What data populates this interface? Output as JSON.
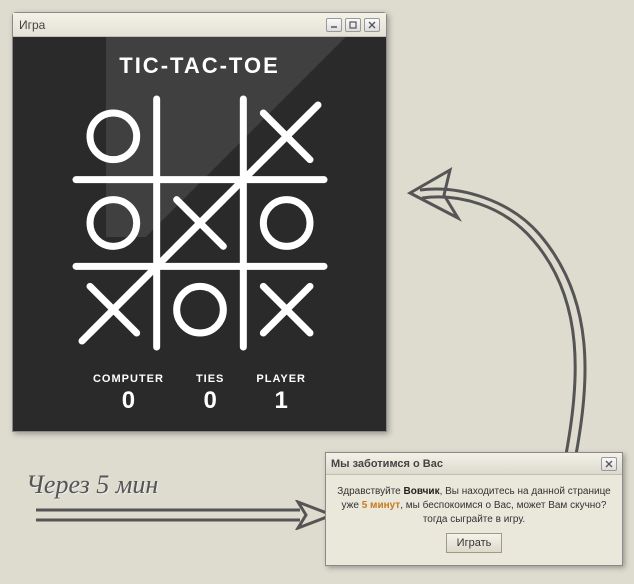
{
  "game": {
    "window_title": "Игра",
    "title": "TIC-TAC-TOE",
    "board": [
      [
        "O",
        "",
        "X"
      ],
      [
        "O",
        "X",
        "O"
      ],
      [
        "X",
        "O",
        "X"
      ]
    ],
    "win_line": [
      0,
      2,
      2,
      0
    ],
    "scores": {
      "computer": {
        "label": "COMPUTER",
        "value": "0"
      },
      "ties": {
        "label": "TIES",
        "value": "0"
      },
      "player": {
        "label": "PLAYER",
        "value": "1"
      }
    }
  },
  "caption": "Через 5 мин",
  "dialog": {
    "title": "Мы заботимся о Вас",
    "greet_prefix": "Здравствуйте ",
    "name": "Вовчик",
    "greet_suffix": ", Вы находитесь на данной странице уже ",
    "duration": "5 минут",
    "tail": ", мы беспокоимся о Вас, может Вам скучно? тогда сыграйте в игру.",
    "button": "Играть"
  }
}
